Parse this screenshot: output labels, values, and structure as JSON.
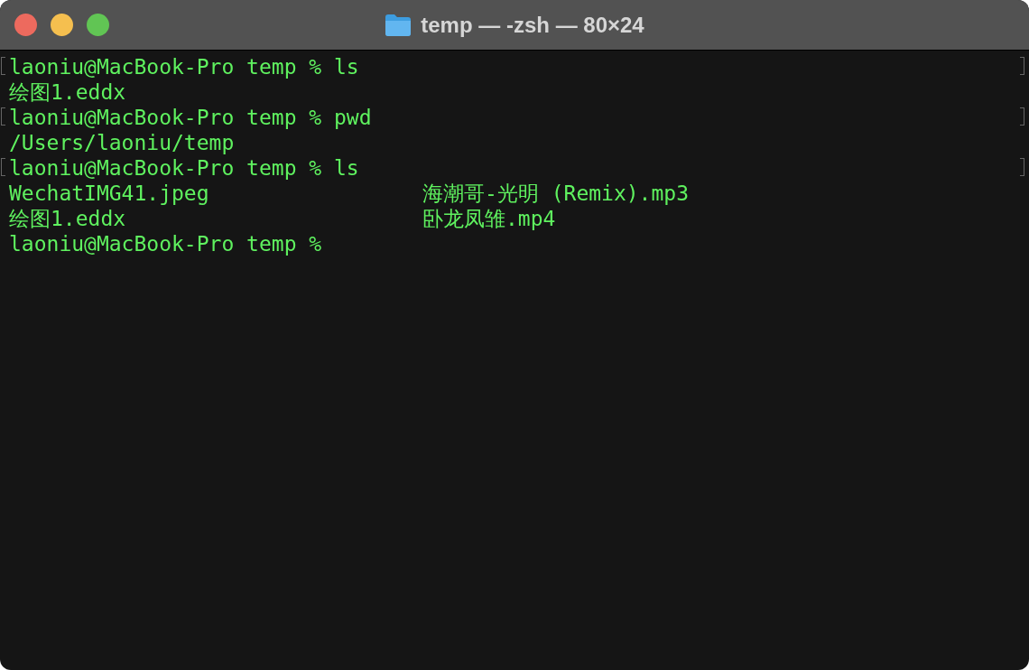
{
  "window": {
    "title": "temp — -zsh — 80×24"
  },
  "terminal": {
    "lines": [
      {
        "kind": "text",
        "text": "laoniu@MacBook-Pro temp % ls",
        "marked": true
      },
      {
        "kind": "text",
        "text": "绘图1.eddx",
        "marked": false
      },
      {
        "kind": "text",
        "text": "laoniu@MacBook-Pro temp % pwd",
        "marked": true
      },
      {
        "kind": "text",
        "text": "/Users/laoniu/temp",
        "marked": false
      },
      {
        "kind": "text",
        "text": "laoniu@MacBook-Pro temp % ls",
        "marked": true
      },
      {
        "kind": "columns",
        "cells": [
          "WechatIMG41.jpeg",
          "海潮哥-光明 (Remix).mp3"
        ],
        "marked": false
      },
      {
        "kind": "columns",
        "cells": [
          "绘图1.eddx",
          "卧龙凤雏.mp4"
        ],
        "marked": false
      },
      {
        "kind": "text",
        "text": "laoniu@MacBook-Pro temp %",
        "marked": false
      }
    ]
  }
}
